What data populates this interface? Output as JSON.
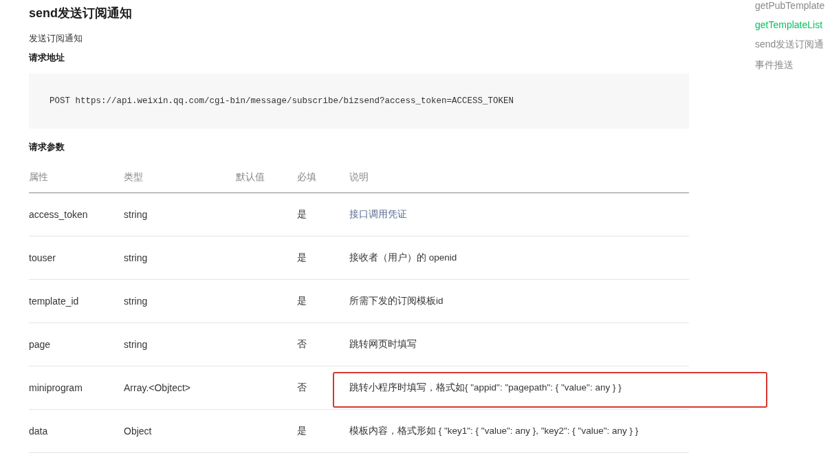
{
  "title": "send发送订阅通知",
  "subtitle": "发送订阅通知",
  "request_url": {
    "heading": "请求地址",
    "code": "POST https://api.weixin.qq.com/cgi-bin/message/subscribe/bizsend?access_token=ACCESS_TOKEN"
  },
  "params": {
    "heading": "请求参数",
    "columns": [
      "属性",
      "类型",
      "默认值",
      "必填",
      "说明"
    ],
    "rows": [
      {
        "cells": [
          "access_token",
          "string",
          "",
          "是",
          "接口调用凭证"
        ],
        "description_link": true,
        "highlighted": false
      },
      {
        "cells": [
          "touser",
          "string",
          "",
          "是",
          "接收者（用户）的 openid"
        ],
        "description_link": false,
        "highlighted": false
      },
      {
        "cells": [
          "template_id",
          "string",
          "",
          "是",
          "所需下发的订阅模板id"
        ],
        "description_link": false,
        "highlighted": false
      },
      {
        "cells": [
          "page",
          "string",
          "",
          "否",
          "跳转网页时填写"
        ],
        "description_link": false,
        "highlighted": false
      },
      {
        "cells": [
          "miniprogram",
          "Array.<Objtect>",
          "",
          "否",
          "跳转小程序时填写，格式如{ \"appid\": \"pagepath\": { \"value\": any } }"
        ],
        "description_link": false,
        "highlighted": true
      },
      {
        "cells": [
          "data",
          "Object",
          "",
          "是",
          "模板内容，格式形如 { \"key1\": { \"value\": any }, \"key2\": { \"value\": any } }"
        ],
        "description_link": false,
        "highlighted": false
      }
    ]
  },
  "sidebar": {
    "items": [
      {
        "label": "getPubTemplate",
        "selected": false
      },
      {
        "label": "getTemplateList",
        "selected": true
      },
      {
        "label": "send发送订阅通",
        "selected": false
      },
      {
        "label": "事件推送",
        "selected": false
      }
    ]
  }
}
